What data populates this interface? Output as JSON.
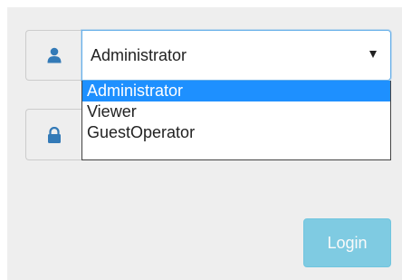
{
  "login": {
    "role_select": {
      "selected_value": "Administrator",
      "icon": "user-icon",
      "options": [
        "Administrator",
        "Viewer",
        "GuestOperator"
      ],
      "highlighted_option": "Administrator"
    },
    "password": {
      "icon": "lock-icon"
    },
    "login_button_label": "Login"
  },
  "colors": {
    "panel_bg": "#eeeeee",
    "icon": "#337ab7",
    "option_highlight": "#1e90ff",
    "login_button": "#5bc0de"
  }
}
